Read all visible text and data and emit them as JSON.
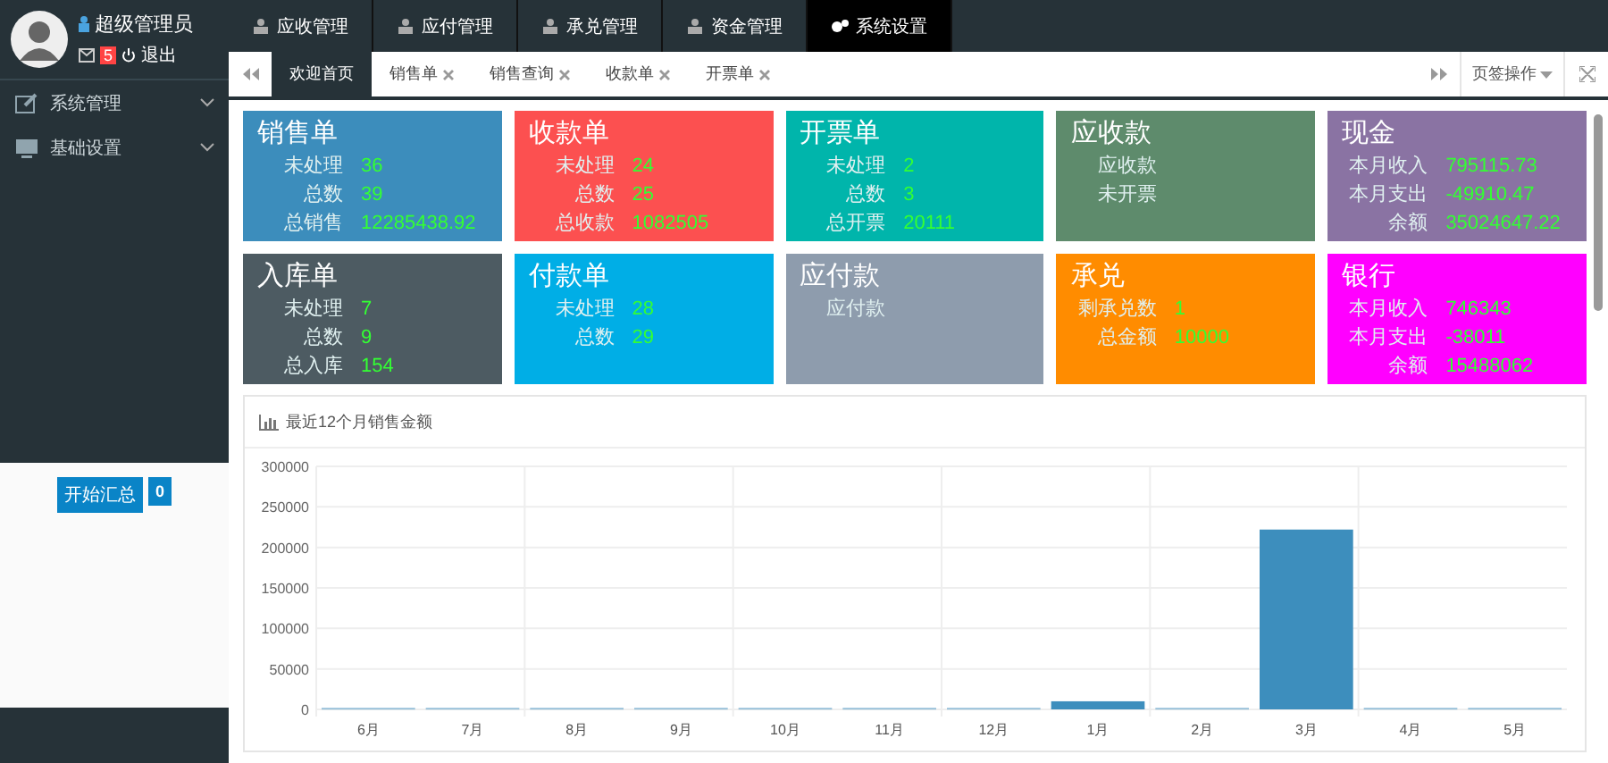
{
  "user": {
    "name": "超级管理员",
    "badge": "5",
    "logout": "退出"
  },
  "sidebar": {
    "items": [
      {
        "label": "系统管理"
      },
      {
        "label": "基础设置"
      }
    ],
    "summary_button": "开始汇总",
    "summary_count": "0"
  },
  "top_menu": [
    {
      "label": "应收管理",
      "selected": false
    },
    {
      "label": "应付管理",
      "selected": false
    },
    {
      "label": "承兑管理",
      "selected": false
    },
    {
      "label": "资金管理",
      "selected": false
    },
    {
      "label": "系统设置",
      "selected": true
    }
  ],
  "page_tabs": [
    {
      "label": "欢迎首页",
      "selected": true,
      "closable": false
    },
    {
      "label": "销售单",
      "selected": false,
      "closable": true
    },
    {
      "label": "销售查询",
      "selected": false,
      "closable": true
    },
    {
      "label": "收款单",
      "selected": false,
      "closable": true
    },
    {
      "label": "开票单",
      "selected": false,
      "closable": true
    }
  ],
  "tab_actions": "页签操作",
  "cards": [
    {
      "title": "销售单",
      "color": "#3c8dbc",
      "rows": [
        {
          "label": "未处理",
          "value": "36"
        },
        {
          "label": "总数",
          "value": "39"
        },
        {
          "label": "总销售",
          "value": "12285438.92"
        }
      ]
    },
    {
      "title": "收款单",
      "color": "#fc5050",
      "rows": [
        {
          "label": "未处理",
          "value": "24"
        },
        {
          "label": "总数",
          "value": "25"
        },
        {
          "label": "总收款",
          "value": "1082505"
        }
      ]
    },
    {
      "title": "开票单",
      "color": "#00b5ab",
      "rows": [
        {
          "label": "未处理",
          "value": "2"
        },
        {
          "label": "总数",
          "value": "3"
        },
        {
          "label": "总开票",
          "value": "20111"
        }
      ]
    },
    {
      "title": "应收款",
      "color": "#5e8b6c",
      "rows": [
        {
          "label": "应收款"
        },
        {
          "label": "未开票"
        }
      ]
    },
    {
      "title": "现金",
      "color": "#8a73a3",
      "rows": [
        {
          "label": "本月收入",
          "value": "795115.73"
        },
        {
          "label": "本月支出",
          "value": "-49910.47"
        },
        {
          "label": "余额",
          "value": "35024647.22"
        }
      ]
    },
    {
      "title": "入库单",
      "color": "#4d5b62",
      "rows": [
        {
          "label": "未处理",
          "value": "7"
        },
        {
          "label": "总数",
          "value": "9"
        },
        {
          "label": "总入库",
          "value": "154"
        }
      ]
    },
    {
      "title": "付款单",
      "color": "#00aee6",
      "rows": [
        {
          "label": "未处理",
          "value": "28"
        },
        {
          "label": "总数",
          "value": "29"
        }
      ]
    },
    {
      "title": "应付款",
      "color": "#8e9cad",
      "rows": [
        {
          "label": "应付款"
        }
      ]
    },
    {
      "title": "承兑",
      "color": "#ff8c00",
      "rows": [
        {
          "label": "剩承兑数",
          "value": "1"
        },
        {
          "label": "总金额",
          "value": "10000"
        }
      ]
    },
    {
      "title": "银行",
      "color": "#ff00ff",
      "rows": [
        {
          "label": "本月收入",
          "value": "746343"
        },
        {
          "label": "本月支出",
          "value": "-38011"
        },
        {
          "label": "余额",
          "value": "15488062"
        }
      ]
    }
  ],
  "chart_panel": {
    "title": "最近12个月销售金额",
    "chart_data": {
      "type": "bar",
      "categories": [
        "6月",
        "7月",
        "8月",
        "9月",
        "10月",
        "11月",
        "12月",
        "1月",
        "2月",
        "3月",
        "4月",
        "5月"
      ],
      "series": [
        {
          "color": "#3d8ebd",
          "values": [
            2000,
            2000,
            2000,
            2000,
            2000,
            2000,
            2000,
            10000,
            2000,
            222000,
            2000,
            2000
          ]
        }
      ],
      "grid": true,
      "ylim": [
        0,
        300000
      ],
      "yticks": [
        0,
        50000,
        100000,
        150000,
        200000,
        250000,
        300000
      ]
    }
  }
}
